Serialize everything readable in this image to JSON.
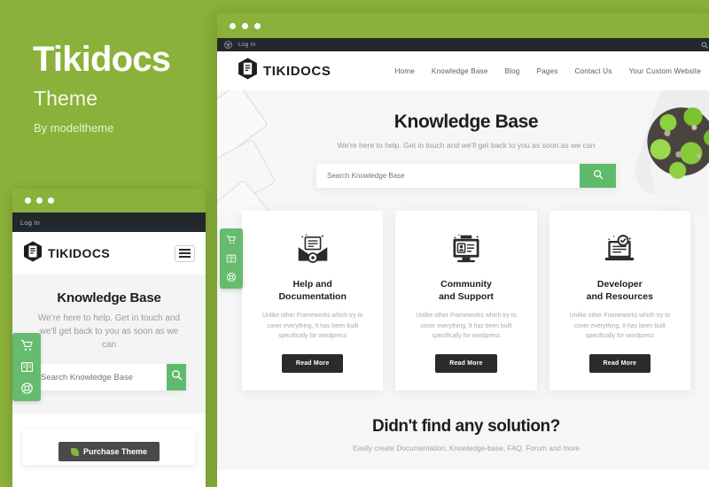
{
  "promo": {
    "title": "Tikidocs",
    "subtitle": "Theme",
    "author": "By modeltheme",
    "brand_green": "#8AB139",
    "accent_green": "#5FBB6B"
  },
  "admin_bar": {
    "wp_icon": "wordpress-icon",
    "login_label": "Log In",
    "search_icon": "search-icon"
  },
  "site": {
    "logo_icon": "tikidocs-hexagon-document-icon",
    "logo_text": "TIKIDOCS",
    "nav": [
      {
        "label": "Home"
      },
      {
        "label": "Knowledge Base"
      },
      {
        "label": "Blog"
      },
      {
        "label": "Pages"
      },
      {
        "label": "Contact Us"
      },
      {
        "label": "Your Custom Website"
      }
    ],
    "nav_search_icon": "search-icon",
    "mobile_menu_icon": "hamburger-menu-icon"
  },
  "hero": {
    "heading": "Knowledge Base",
    "subheading": "We're here to help. Get in touch and we'll get back to you as soon as we can",
    "search_placeholder": "Search Knowledge Base",
    "search_value": "",
    "search_button_icon": "search-icon"
  },
  "side_tabs": [
    {
      "icon": "shopping-cart-icon",
      "name": "cart"
    },
    {
      "icon": "book-icon",
      "name": "documentation"
    },
    {
      "icon": "lifebuoy-support-icon",
      "name": "support"
    }
  ],
  "cards": [
    {
      "icon": "document-gear-icon",
      "title_line1": "Help and",
      "title_line2": "Documentation",
      "body": "Unlike other Frameworks which try to cover everything, It has been built specifically for wordpress",
      "button": "Read More"
    },
    {
      "icon": "monitor-id-card-icon",
      "title_line1": "Community",
      "title_line2": "and Support",
      "body": "Unlike other Frameworks which try to cover everything, It has been built specifically for wordpress",
      "button": "Read More"
    },
    {
      "icon": "laptop-check-icon",
      "title_line1": "Developer",
      "title_line2": "and Resources",
      "body": "Unlike other Frameworks which try to cover everything, It has been built specifically for wordpress",
      "button": "Read More"
    }
  ],
  "bottom_cta": {
    "heading": "Didn't find any solution?",
    "subheading": "Easily create Documentation, Knowledge-base, FAQ, Forum and more"
  },
  "mobile_footer": {
    "purchase_label": "Purchase Theme",
    "purchase_icon": "envato-leaf-icon"
  }
}
